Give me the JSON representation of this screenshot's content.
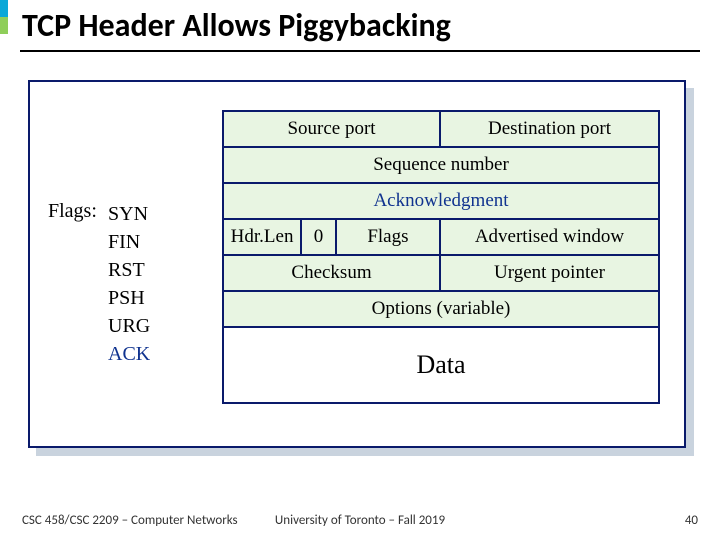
{
  "title": "TCP Header Allows Piggybacking",
  "flags": {
    "label": "Flags:",
    "items": [
      "SYN",
      "FIN",
      "RST",
      "PSH",
      "URG",
      "ACK"
    ],
    "highlight": "ACK"
  },
  "header_rows": {
    "r1": {
      "c1": "Source port",
      "c2": "Destination port"
    },
    "r2": {
      "c1": "Sequence number"
    },
    "r3": {
      "c1": "Acknowledgment"
    },
    "r4": {
      "c1": "Hdr.Len",
      "c2": "0",
      "c3": "Flags",
      "c4": "Advertised window"
    },
    "r5": {
      "c1": "Checksum",
      "c2": "Urgent pointer"
    },
    "r6": {
      "c1": "Options (variable)"
    }
  },
  "data_label": "Data",
  "footer": {
    "left": "CSC 458/CSC 2209 – Computer Networks",
    "center": "University of Toronto – Fall 2019",
    "right": "40"
  }
}
